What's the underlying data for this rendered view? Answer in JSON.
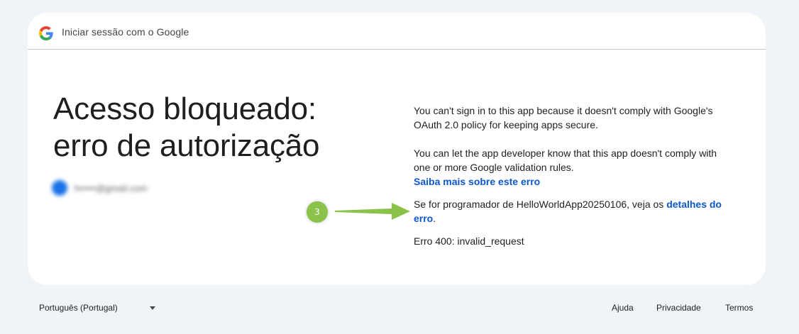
{
  "header": {
    "title": "Iniciar sessão com o Google",
    "logo_icon": "google-g-icon"
  },
  "main": {
    "headline_line1": "Acesso bloqueado:",
    "headline_line2": "erro de autorização",
    "account_email": "h•••••@gmail.com",
    "paragraph1": "You can't sign in to this app because it doesn't comply with Google's OAuth 2.0 policy for keeping apps secure.",
    "paragraph2": "You can let the app developer know that this app doesn't comply with one or more Google validation rules.",
    "learn_more_link": "Saiba mais sobre este erro",
    "developer_text": "Se for programador de HelloWorldApp20250106, veja os ",
    "developer_link": "detalhes do erro",
    "developer_suffix": ".",
    "error_code": "Erro 400: invalid_request"
  },
  "annotation": {
    "marker_label": "3",
    "marker_color": "#8bc34a"
  },
  "footer": {
    "language": "Português (Portugal)",
    "help": "Ajuda",
    "privacy": "Privacidade",
    "terms": "Termos"
  },
  "colors": {
    "link": "#0b57d0",
    "background": "#f0f4f9",
    "card": "#ffffff"
  }
}
